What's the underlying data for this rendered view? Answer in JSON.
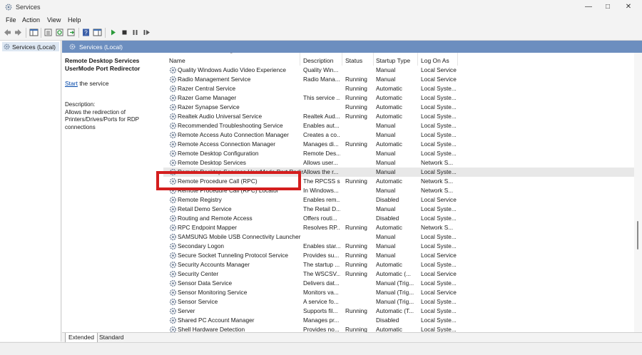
{
  "window": {
    "title": "Services"
  },
  "menu": [
    "File",
    "Action",
    "View",
    "Help"
  ],
  "tree": {
    "item": "Services (Local)"
  },
  "header": {
    "label": "Services (Local)"
  },
  "details": {
    "title": "Remote Desktop Services UserMode Port Redirector",
    "start_link": "Start",
    "start_rest": " the service",
    "desc_label": "Description:",
    "desc_text": "Allows the redirection of Printers/Drives/Ports for RDP connections"
  },
  "columns": {
    "name": "Name",
    "description": "Description",
    "status": "Status",
    "startup": "Startup Type",
    "logon": "Log On As"
  },
  "rows": [
    {
      "name": "Quality Windows Audio Video Experience",
      "desc": "Quality Win...",
      "status": "",
      "startup": "Manual",
      "logon": "Local Service"
    },
    {
      "name": "Radio Management Service",
      "desc": "Radio Mana...",
      "status": "Running",
      "startup": "Manual",
      "logon": "Local Service"
    },
    {
      "name": "Razer Central Service",
      "desc": "",
      "status": "Running",
      "startup": "Automatic",
      "logon": "Local Syste..."
    },
    {
      "name": "Razer Game Manager",
      "desc": "This service ...",
      "status": "Running",
      "startup": "Automatic",
      "logon": "Local Syste..."
    },
    {
      "name": "Razer Synapse Service",
      "desc": "",
      "status": "Running",
      "startup": "Automatic",
      "logon": "Local Syste..."
    },
    {
      "name": "Realtek Audio Universal Service",
      "desc": "Realtek Aud...",
      "status": "Running",
      "startup": "Automatic",
      "logon": "Local Syste..."
    },
    {
      "name": "Recommended Troubleshooting Service",
      "desc": "Enables aut...",
      "status": "",
      "startup": "Manual",
      "logon": "Local Syste..."
    },
    {
      "name": "Remote Access Auto Connection Manager",
      "desc": "Creates a co...",
      "status": "",
      "startup": "Manual",
      "logon": "Local Syste..."
    },
    {
      "name": "Remote Access Connection Manager",
      "desc": "Manages di...",
      "status": "Running",
      "startup": "Automatic",
      "logon": "Local Syste..."
    },
    {
      "name": "Remote Desktop Configuration",
      "desc": "Remote Des...",
      "status": "",
      "startup": "Manual",
      "logon": "Local Syste..."
    },
    {
      "name": "Remote Desktop Services",
      "desc": "Allows user...",
      "status": "",
      "startup": "Manual",
      "logon": "Network S..."
    },
    {
      "name": "Remote Desktop Services UserMode Port Redirector",
      "desc": "Allows the r...",
      "status": "",
      "startup": "Manual",
      "logon": "Local Syste...",
      "selected": true
    },
    {
      "name": "Remote Procedure Call (RPC)",
      "desc": "The RPCSS s...",
      "status": "Running",
      "startup": "Automatic",
      "logon": "Network S..."
    },
    {
      "name": "Remote Procedure Call (RPC) Locator",
      "desc": "In Windows...",
      "status": "",
      "startup": "Manual",
      "logon": "Network S..."
    },
    {
      "name": "Remote Registry",
      "desc": "Enables rem...",
      "status": "",
      "startup": "Disabled",
      "logon": "Local Service"
    },
    {
      "name": "Retail Demo Service",
      "desc": "The Retail D...",
      "status": "",
      "startup": "Manual",
      "logon": "Local Syste..."
    },
    {
      "name": "Routing and Remote Access",
      "desc": "Offers routi...",
      "status": "",
      "startup": "Disabled",
      "logon": "Local Syste..."
    },
    {
      "name": "RPC Endpoint Mapper",
      "desc": "Resolves RP...",
      "status": "Running",
      "startup": "Automatic",
      "logon": "Network S..."
    },
    {
      "name": "SAMSUNG Mobile USB Connectivity Launcher",
      "desc": "",
      "status": "",
      "startup": "Manual",
      "logon": "Local Syste..."
    },
    {
      "name": "Secondary Logon",
      "desc": "Enables star...",
      "status": "Running",
      "startup": "Manual",
      "logon": "Local Syste..."
    },
    {
      "name": "Secure Socket Tunneling Protocol Service",
      "desc": "Provides su...",
      "status": "Running",
      "startup": "Manual",
      "logon": "Local Service"
    },
    {
      "name": "Security Accounts Manager",
      "desc": "The startup ...",
      "status": "Running",
      "startup": "Automatic",
      "logon": "Local Syste..."
    },
    {
      "name": "Security Center",
      "desc": "The WSCSV...",
      "status": "Running",
      "startup": "Automatic (...",
      "logon": "Local Service"
    },
    {
      "name": "Sensor Data Service",
      "desc": "Delivers dat...",
      "status": "",
      "startup": "Manual (Trig...",
      "logon": "Local Syste..."
    },
    {
      "name": "Sensor Monitoring Service",
      "desc": "Monitors va...",
      "status": "",
      "startup": "Manual (Trig...",
      "logon": "Local Service"
    },
    {
      "name": "Sensor Service",
      "desc": "A service fo...",
      "status": "",
      "startup": "Manual (Trig...",
      "logon": "Local Syste..."
    },
    {
      "name": "Server",
      "desc": "Supports fil...",
      "status": "Running",
      "startup": "Automatic (T...",
      "logon": "Local Syste..."
    },
    {
      "name": "Shared PC Account Manager",
      "desc": "Manages pr...",
      "status": "",
      "startup": "Disabled",
      "logon": "Local Syste..."
    },
    {
      "name": "Shell Hardware Detection",
      "desc": "Provides no...",
      "status": "Running",
      "startup": "Automatic",
      "logon": "Local Syste..."
    }
  ],
  "tabs": [
    "Extended",
    "Standard"
  ],
  "colors": {
    "header_blue": "#6c8ebf",
    "highlight_red": "#d41e1e",
    "link_blue": "#0046a8"
  }
}
